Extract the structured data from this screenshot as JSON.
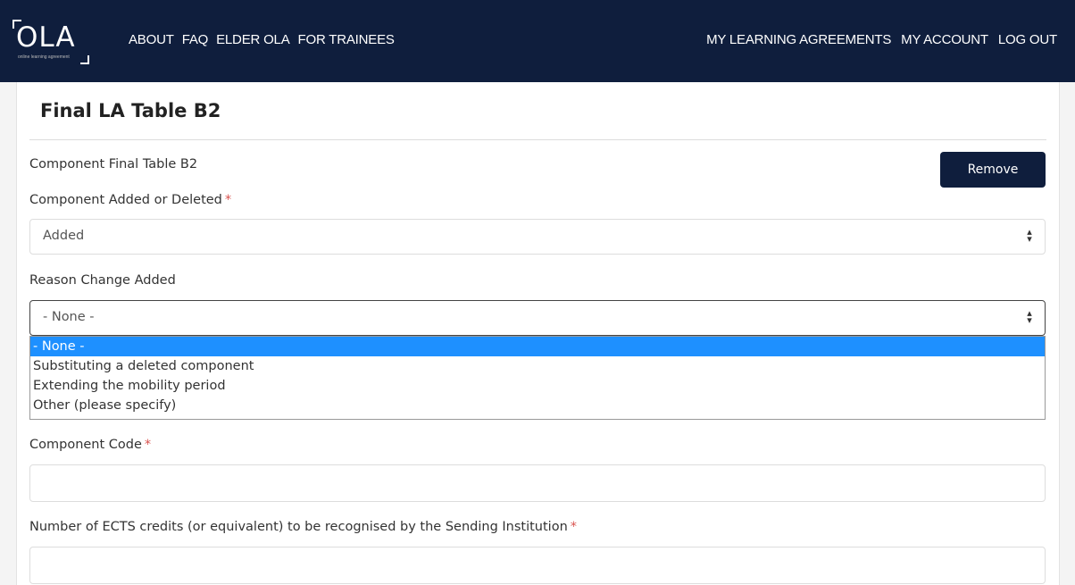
{
  "brand": {
    "logo_text": "OLA",
    "logo_subtext": "online learning agreement"
  },
  "nav": {
    "left": [
      "ABOUT",
      "FAQ",
      "ELDER OLA",
      "FOR TRAINEES"
    ],
    "right": [
      "MY LEARNING AGREEMENTS",
      "MY ACCOUNT",
      "LOG OUT"
    ]
  },
  "page": {
    "title": "Final LA Table B2",
    "component_label": "Component Final Table B2",
    "remove_label": "Remove"
  },
  "form": {
    "added_deleted_label": "Component Added or Deleted",
    "added_deleted_value": "Added",
    "reason_label": "Reason Change Added",
    "reason_value": "- None -",
    "reason_options": [
      "- None -",
      "Substituting a deleted component",
      "Extending the mobility period",
      "Other (please specify)"
    ],
    "component_code_label": "Component Code",
    "component_code_value": "",
    "ects_label": "Number of ECTS credits (or equivalent) to be recognised by the Sending Institution",
    "ects_value": "",
    "required_marker": "*"
  },
  "icons": {
    "select_arrow": "up-down-arrows-icon"
  },
  "colors": {
    "navbar": "#0f1e3d",
    "button": "#0f1e3d",
    "highlight": "#1e90ff",
    "required": "#d9534f"
  }
}
